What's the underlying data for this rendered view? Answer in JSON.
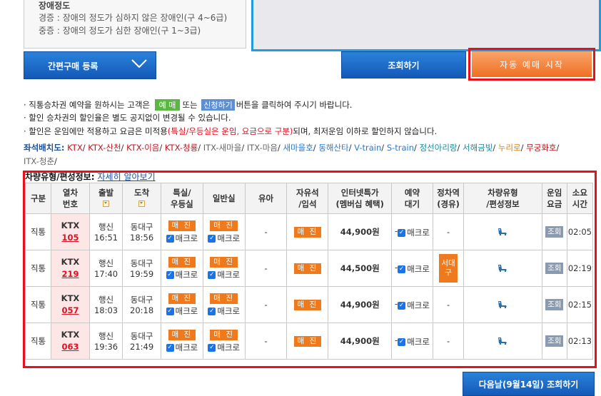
{
  "disability_info": {
    "title": "장애정도",
    "line1": "경증 : 장애의 정도가 심하지 않은 장애인(구 4~6급)",
    "line2": "중증 : 장애의 정도가 심한 장애인(구 1~3급)"
  },
  "buttons": {
    "quick_register": "간편구매 등록",
    "lookup": "조회하기",
    "auto_reserve": "자동 예매 시작",
    "next_day": "다음날(9월14일) 조회하기"
  },
  "notices": {
    "n1_pre": "· 직통승차권 예약을 원하시는 고객은",
    "n1_badge1": "예 매",
    "n1_mid": "또는",
    "n1_badge2": "신청하기",
    "n1_post": "버튼을 클릭하여 주시기 바랍니다.",
    "n2": "· 할인 승차권의 할인율은 별도 공지없이 변경될 수 있습니다.",
    "n3_pre": "· 할인은 운임에만 적용하고 요금은 미적용",
    "n3_red": "(특실/우등실은 운임, 요금으로 구분)",
    "n3_post": "되며, 최저운임 이하로 할인하지 않습니다."
  },
  "seat_layout": {
    "label": "좌석배치도:",
    "links": [
      {
        "text": "KTX",
        "color": "#c8101a"
      },
      {
        "text": "KTX-산천",
        "color": "#c8101a"
      },
      {
        "text": "KTX-이음",
        "color": "#c8101a"
      },
      {
        "text": "KTX-청룡",
        "color": "#c8101a"
      },
      {
        "text": "ITX-새마을",
        "color": "#666666"
      },
      {
        "text": "ITX-마음",
        "color": "#666666"
      },
      {
        "text": "새마을호",
        "color": "#2979d0"
      },
      {
        "text": "동해산타",
        "color": "#2979d0"
      },
      {
        "text": "V-train",
        "color": "#2979d0"
      },
      {
        "text": "S-train",
        "color": "#2979d0"
      },
      {
        "text": "정선아리랑",
        "color": "#178a9a"
      },
      {
        "text": "서해금빛",
        "color": "#178a9a"
      },
      {
        "text": "누리로",
        "color": "#d9800d"
      },
      {
        "text": "무궁화호",
        "color": "#c8101a"
      },
      {
        "text": "ITX-청춘",
        "color": "#666666"
      }
    ]
  },
  "table": {
    "caption": "차량유형/편성정보:",
    "caption_link": "자세히 알아보기",
    "headers": [
      "구분",
      "열차\n번호",
      "출발",
      "도착",
      "특실/\n우등실",
      "일반실",
      "유아",
      "자유석\n/입석",
      "인터넷특가\n(멤버십 혜택)",
      "예약\n대기",
      "정차역\n(경유)",
      "차량유형\n/편성정보",
      "운임\n요금",
      "소요\n시간"
    ],
    "rows": [
      {
        "type": "직통",
        "train": "KTX",
        "no": "105",
        "dep_st": "행신",
        "dep_time": "16:51",
        "arr_st": "동대구",
        "arr_time": "18:56",
        "first": "매 진",
        "normal": "매 진",
        "macro": "매크로",
        "infant": "-",
        "free": "매 진",
        "price": "44,900원",
        "wait": "-",
        "stops": "-",
        "fare": "조회",
        "duration": "02:05"
      },
      {
        "type": "직통",
        "train": "KTX",
        "no": "219",
        "dep_st": "행신",
        "dep_time": "17:40",
        "arr_st": "동대구",
        "arr_time": "19:59",
        "first": "매 진",
        "normal": "매 진",
        "macro": "매크로",
        "infant": "-",
        "free": "매 진",
        "price": "44,500원",
        "wait": "-",
        "stops": "서대구",
        "fare": "조회",
        "duration": "02:19"
      },
      {
        "type": "직통",
        "train": "KTX",
        "no": "057",
        "dep_st": "행신",
        "dep_time": "18:03",
        "arr_st": "동대구",
        "arr_time": "20:18",
        "first": "매 진",
        "normal": "매 진",
        "macro": "매크로",
        "infant": "-",
        "free": "매 진",
        "price": "44,900원",
        "wait": "-",
        "stops": "-",
        "fare": "조회",
        "duration": "02:15"
      },
      {
        "type": "직통",
        "train": "KTX",
        "no": "063",
        "dep_st": "행신",
        "dep_time": "19:36",
        "arr_st": "동대구",
        "arr_time": "21:49",
        "first": "매 진",
        "normal": "매 진",
        "macro": "매크로",
        "infant": "-",
        "free": "매 진",
        "price": "44,900원",
        "wait": "-",
        "stops": "-",
        "fare": "조회",
        "duration": "02:13"
      }
    ]
  }
}
